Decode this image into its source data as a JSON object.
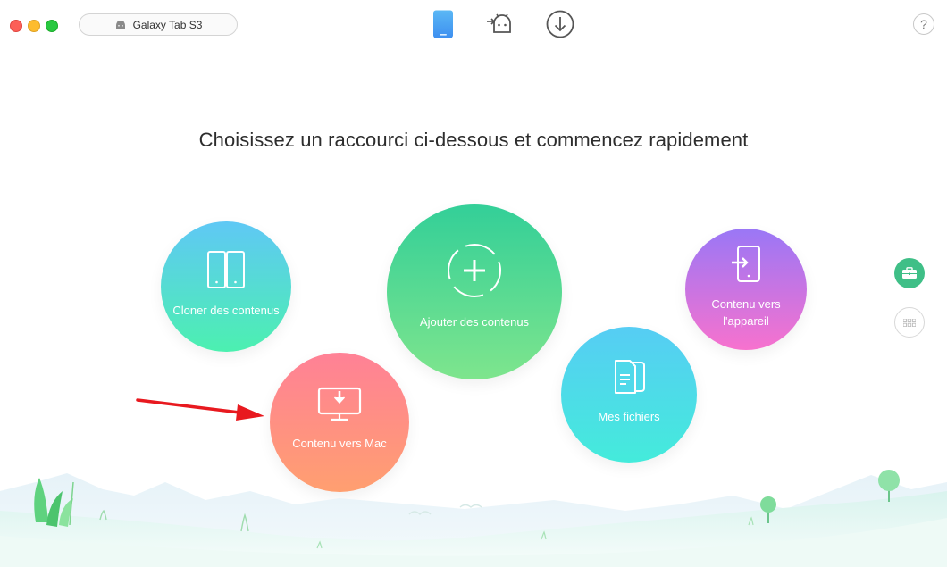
{
  "window": {
    "device_name": "Galaxy Tab S3",
    "toolbar_icons": [
      "phone-icon",
      "android-transfer-icon",
      "download-icon"
    ],
    "help_label": "?"
  },
  "main": {
    "heading": "Choisissez un raccourci ci-dessous et commencez rapidement",
    "shortcuts": [
      {
        "label": "Cloner des contenus",
        "icon": "clone-icon"
      },
      {
        "label": "Ajouter des contenus",
        "icon": "add-icon"
      },
      {
        "label": "Contenu vers l'appareil",
        "icon": "device-import-icon"
      },
      {
        "label": "Mes fichiers",
        "icon": "files-icon"
      },
      {
        "label": "Contenu vers Mac",
        "icon": "mac-export-icon"
      }
    ]
  },
  "sidebar": {
    "buttons": [
      "toolbox-icon",
      "grid-icon"
    ]
  },
  "colors": {
    "accent_green": "#3fbf87",
    "phone_blue": "#4aa8f0",
    "arrow_red": "#e8191f"
  }
}
